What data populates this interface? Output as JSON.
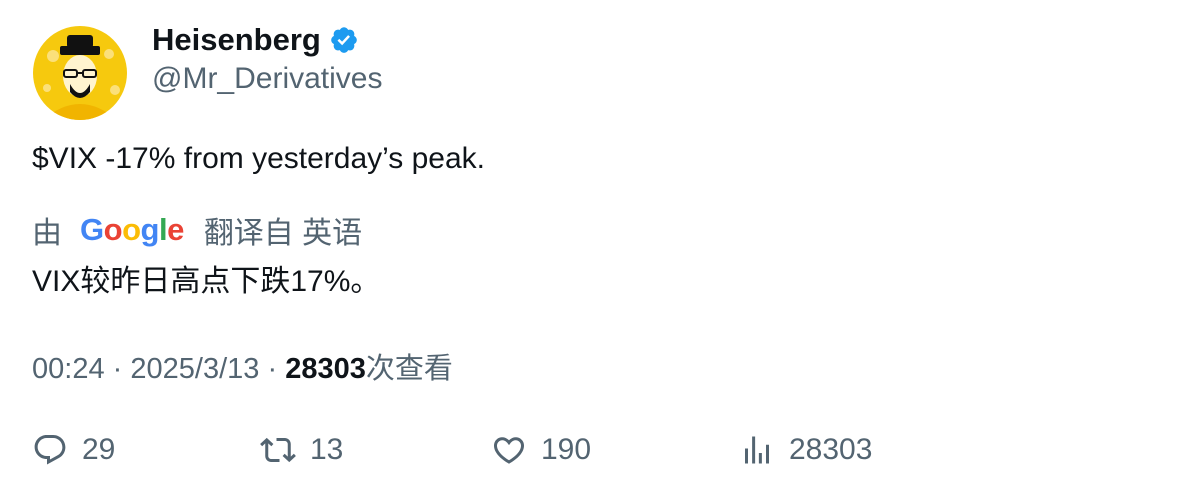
{
  "author": {
    "display_name": "Heisenberg",
    "handle": "@Mr_Derivatives",
    "verified_icon": "verified-badge-icon",
    "avatar_icon": "heisenberg-avatar"
  },
  "tweet": {
    "text": "$VIX -17% from yesterday’s peak."
  },
  "translation": {
    "by_label": "由",
    "provider": "Google",
    "link_label": "翻译自 英语",
    "text": "VIX较昨日高点下跌17%。"
  },
  "meta": {
    "time": "00:24",
    "separator": "·",
    "date": "2025/3/13",
    "views_count": "28303",
    "views_label": "次查看"
  },
  "actions": {
    "replies": "29",
    "retweets": "13",
    "likes": "190",
    "views": "28303"
  },
  "colors": {
    "text_primary": "#0f1419",
    "text_secondary": "#536471",
    "verified_blue": "#1d9bf0",
    "avatar_yellow": "#f6c90e"
  }
}
